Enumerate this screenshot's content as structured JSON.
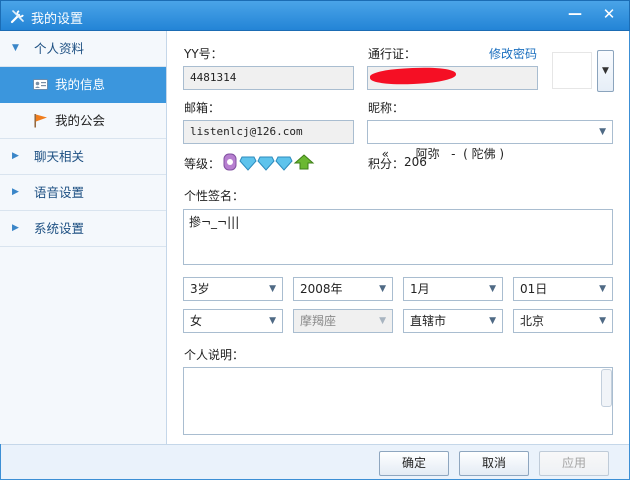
{
  "window": {
    "title": "我的设置",
    "minimize_glyph": "—",
    "close_glyph": "✕"
  },
  "sidebar": {
    "groups": [
      {
        "label": "个人资料",
        "expanded": true
      },
      {
        "label": "聊天相关",
        "expanded": false
      },
      {
        "label": "语音设置",
        "expanded": false
      },
      {
        "label": "系统设置",
        "expanded": false
      }
    ],
    "sub_items": [
      {
        "label": "我的信息",
        "icon": "id-card-icon",
        "active": true
      },
      {
        "label": "我的公会",
        "icon": "flag-icon",
        "active": false
      }
    ],
    "expanded_glyph": "▼",
    "collapsed_glyph": "▶"
  },
  "profile": {
    "yy_label": "YY号：",
    "yy_value": "4481314",
    "pass_label": "通行证：",
    "change_password": "修改密码",
    "email_label": "邮箱：",
    "email_value": "listenlcj@126.com",
    "nickname_label": "昵称：",
    "nickname_value": "«       阿弥   -  ( 陀佛 )",
    "level_label": "等级：",
    "points_label": "积分：",
    "points_value": "206",
    "signature_label": "个性签名：",
    "signature_value": "摻¬_¬|||",
    "description_label": "个人说明：",
    "description_value": ""
  },
  "selects": {
    "age": "3岁",
    "year": "2008年",
    "month": "1月",
    "day": "01日",
    "gender": "女",
    "zodiac": "摩羯座",
    "province": "直辖市",
    "city": "北京",
    "arrow_glyph": "▼"
  },
  "footer": {
    "ok": "确定",
    "cancel": "取消",
    "apply": "应用"
  },
  "colors": {
    "titlebar": "#2384d6",
    "active_nav": "#3b96dd",
    "link": "#1a6fbf",
    "redaction": "#f50f24"
  }
}
